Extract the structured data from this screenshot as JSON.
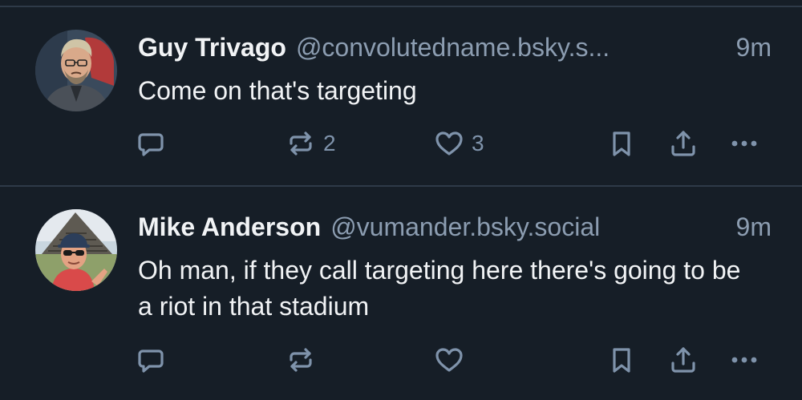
{
  "posts": [
    {
      "author": {
        "display_name": "Guy Trivago",
        "handle": "@convolutedname.bsky.s...",
        "avatar": "avatar-photo-man-grey-hair"
      },
      "timestamp": "9m",
      "text": "Come on that's targeting",
      "actions": {
        "reply_count": "",
        "repost_count": "2",
        "like_count": "3"
      }
    },
    {
      "author": {
        "display_name": "Mike Anderson",
        "handle": "@vumander.bsky.social",
        "avatar": "avatar-photo-man-sunglasses-pyramid"
      },
      "timestamp": "9m",
      "text": "Oh man, if they call targeting here there's going to be a riot in that stadium",
      "actions": {
        "reply_count": "",
        "repost_count": "",
        "like_count": ""
      }
    }
  ],
  "icons": {
    "reply": "speech-bubble-icon",
    "repost": "repost-arrows-icon",
    "like": "heart-icon",
    "bookmark": "bookmark-icon",
    "share": "share-upload-icon",
    "more": "more-dots-icon"
  },
  "colors": {
    "background": "#161e27",
    "divider": "#2e3a48",
    "primary_text": "#f1f3f5",
    "secondary_text": "#8c9db1",
    "icon": "#7f93ab"
  }
}
